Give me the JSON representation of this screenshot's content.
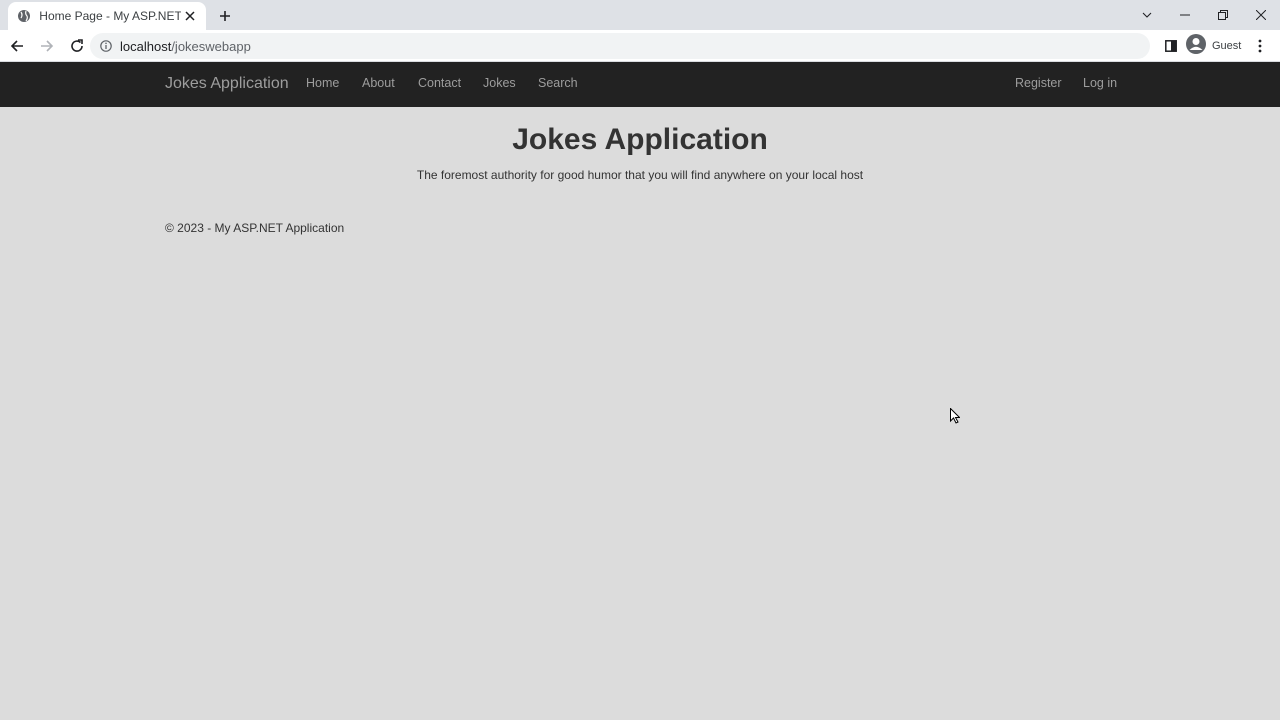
{
  "browser": {
    "tab_title": "Home Page - My ASP.NET Applic",
    "url_host": "localhost",
    "url_path": "/jokeswebapp",
    "profile_label": "Guest"
  },
  "site": {
    "brand": "Jokes Application",
    "nav_left": [
      "Home",
      "About",
      "Contact",
      "Jokes",
      "Search"
    ],
    "nav_right": [
      "Register",
      "Log in"
    ]
  },
  "main": {
    "title": "Jokes Application",
    "lead": "The foremost authority for good humor that you will find anywhere on your local host"
  },
  "footer": {
    "text": "© 2023 - My ASP.NET Application"
  },
  "icons": {
    "favicon": "globe-icon",
    "tab_close": "close-icon",
    "new_tab": "plus-icon",
    "back": "back-arrow-icon",
    "forward": "forward-arrow-icon",
    "reload": "reload-icon",
    "site_info": "info-icon",
    "side_panel": "side-panel-icon",
    "avatar": "avatar-icon",
    "menu": "kebab-menu-icon"
  },
  "colors": {
    "navbar_bg": "#222222",
    "navbar_text": "#9d9d9d",
    "page_bg": "#dcdcdc",
    "text": "#333333"
  }
}
